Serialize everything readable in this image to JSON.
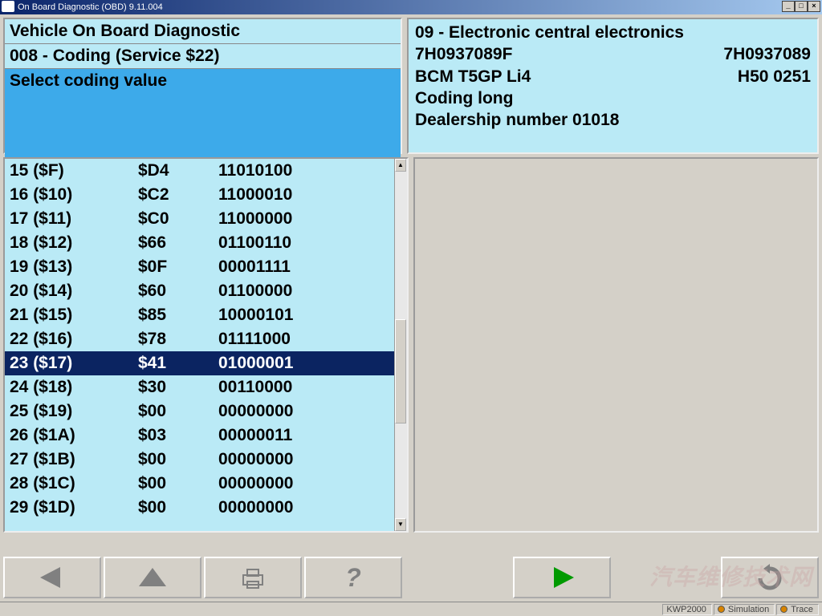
{
  "window": {
    "title": "On Board Diagnostic (OBD) 9.11.004"
  },
  "header_left": {
    "line1": "Vehicle On Board Diagnostic",
    "line2": "008 - Coding (Service $22)",
    "line3": "Select coding value"
  },
  "header_right": {
    "ecu_title": "09 - Electronic central electronics",
    "part_no_1": "7H0937089F",
    "part_no_2": "7H0937089",
    "component": "BCM T5GP Li4",
    "sw_version": "H50  0251",
    "coding_type": "Coding long",
    "dealership": "Dealership number 01018"
  },
  "coding_rows": [
    {
      "idx": "15",
      "hexidx": "($F)",
      "hex": "$D4",
      "bin": "11010100",
      "selected": false
    },
    {
      "idx": "16",
      "hexidx": "($10)",
      "hex": "$C2",
      "bin": "11000010",
      "selected": false
    },
    {
      "idx": "17",
      "hexidx": "($11)",
      "hex": "$C0",
      "bin": "11000000",
      "selected": false
    },
    {
      "idx": "18",
      "hexidx": "($12)",
      "hex": "$66",
      "bin": "01100110",
      "selected": false
    },
    {
      "idx": "19",
      "hexidx": "($13)",
      "hex": "$0F",
      "bin": "00001111",
      "selected": false
    },
    {
      "idx": "20",
      "hexidx": "($14)",
      "hex": "$60",
      "bin": "01100000",
      "selected": false
    },
    {
      "idx": "21",
      "hexidx": "($15)",
      "hex": "$85",
      "bin": "10000101",
      "selected": false
    },
    {
      "idx": "22",
      "hexidx": "($16)",
      "hex": "$78",
      "bin": "01111000",
      "selected": false
    },
    {
      "idx": "23",
      "hexidx": "($17)",
      "hex": "$41",
      "bin": "01000001",
      "selected": true
    },
    {
      "idx": "24",
      "hexidx": "($18)",
      "hex": "$30",
      "bin": "00110000",
      "selected": false
    },
    {
      "idx": "25",
      "hexidx": "($19)",
      "hex": "$00",
      "bin": "00000000",
      "selected": false
    },
    {
      "idx": "26",
      "hexidx": "($1A)",
      "hex": "$03",
      "bin": "00000011",
      "selected": false
    },
    {
      "idx": "27",
      "hexidx": "($1B)",
      "hex": "$00",
      "bin": "00000000",
      "selected": false
    },
    {
      "idx": "28",
      "hexidx": "($1C)",
      "hex": "$00",
      "bin": "00000000",
      "selected": false
    },
    {
      "idx": "29",
      "hexidx": "($1D)",
      "hex": "$00",
      "bin": "00000000",
      "selected": false
    }
  ],
  "status": {
    "protocol": "KWP2000",
    "simulation": "Simulation",
    "trace": "Trace"
  },
  "watermark": "汽车维修技术网",
  "colors": {
    "panel_bg": "#baeaf6",
    "highlight_bg": "#3daaea",
    "selection_bg": "#0b2461"
  }
}
